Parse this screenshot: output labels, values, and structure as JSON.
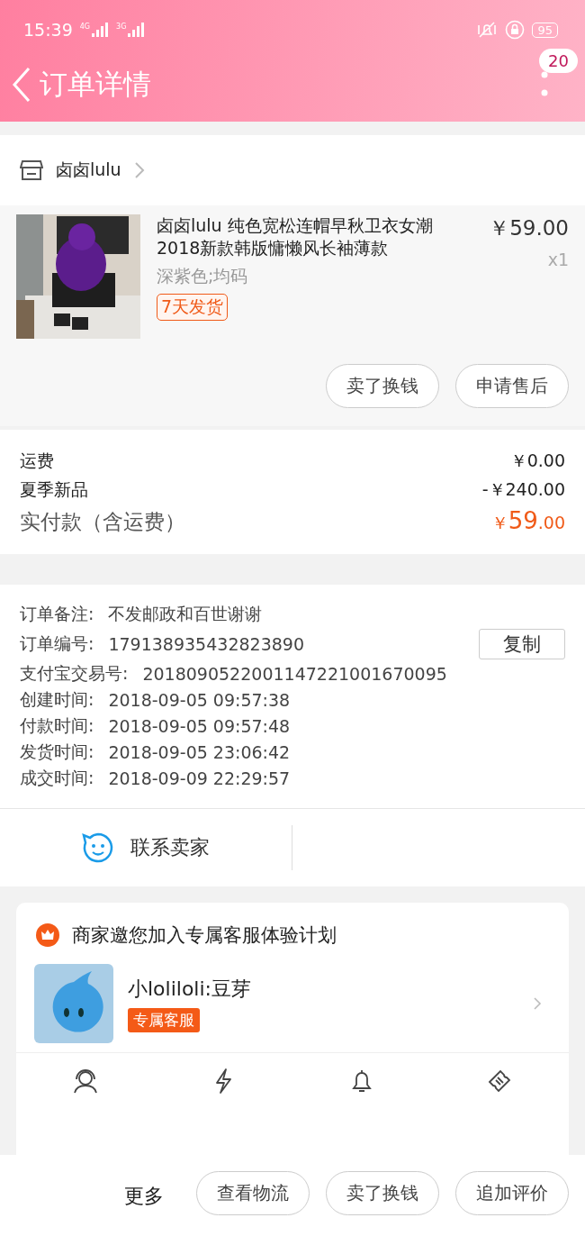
{
  "status_bar": {
    "time": "15:39",
    "signals": [
      "4G",
      "3G"
    ],
    "battery": "95"
  },
  "nav": {
    "title": "订单详情",
    "badge": "20"
  },
  "shop": {
    "name": "卤卤lulu"
  },
  "item": {
    "kind": "picture",
    "title": "卤卤lulu 纯色宽松连帽早秋卫衣女潮2018新款韩版慵懒风长袖薄款",
    "price": "￥59.00",
    "quantity": "x1",
    "variant": "深紫色;均码",
    "tag": "7天发货",
    "buttons": [
      "卖了换钱",
      "申请售后"
    ]
  },
  "fees": [
    {
      "label": "运费",
      "value": "￥0.00",
      "kind": "normal"
    },
    {
      "label": "夏季新品",
      "value": "-￥240.00",
      "kind": "normal"
    },
    {
      "label": "实付款（含运费）",
      "currency": "￥",
      "value": "59",
      "decimals": ".00",
      "kind": "total"
    }
  ],
  "info": [
    {
      "label": "订单备注:",
      "value": "不发邮政和百世谢谢"
    },
    {
      "label": "订单编号:",
      "value": "179138935432823890",
      "button": "复制"
    },
    {
      "label": "支付宝交易号:",
      "value": "2018090522001147221001670095"
    },
    {
      "label": "创建时间:",
      "value": "2018-09-05 09:57:38"
    },
    {
      "label": "付款时间:",
      "value": "2018-09-05 09:57:48"
    },
    {
      "label": "发货时间:",
      "value": "2018-09-05 23:06:42"
    },
    {
      "label": "成交时间:",
      "value": "2018-09-09 22:29:57"
    }
  ],
  "contact": {
    "label": "联系卖家"
  },
  "service_card": {
    "title": "商家邀您加入专属客服体验计划",
    "agent": "小loliloli:豆芽",
    "agent_tag": "专属客服",
    "features": [
      {
        "kind": "headset"
      },
      {
        "kind": "bolt"
      },
      {
        "kind": "bell"
      },
      {
        "kind": "ticket"
      }
    ]
  },
  "bottom_bar": {
    "more": "更多",
    "buttons": [
      "查看物流",
      "卖了换钱",
      "追加评价"
    ]
  }
}
